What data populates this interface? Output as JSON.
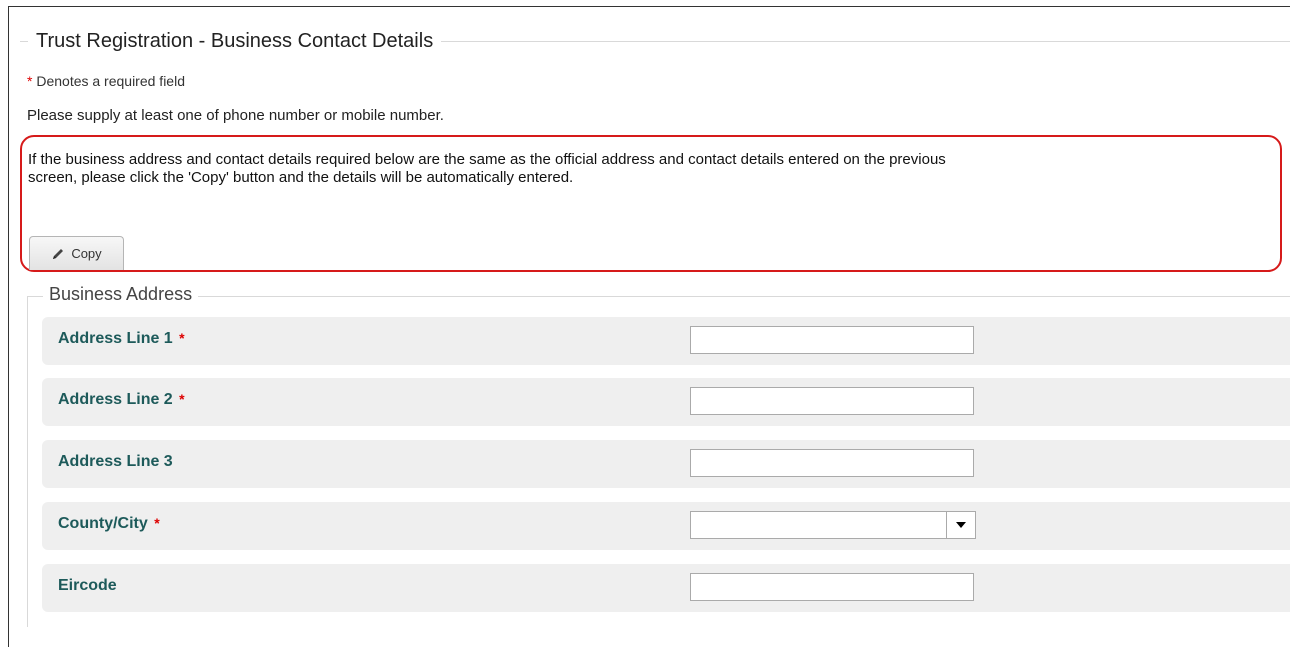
{
  "page_title": "Trust Registration - Business Contact Details",
  "required_note": {
    "star": "*",
    "text": "Denotes a required field"
  },
  "supply_note": "Please supply at least one of phone number or mobile number.",
  "copy_section": {
    "instruction_line1": "If the business address and contact details required below are the same as the official address and contact details entered on the previous",
    "instruction_line2": "screen, please click the 'Copy' button and the details will be automatically entered.",
    "button_label": "Copy",
    "button_icon": "pencil-icon",
    "highlight_color": "#d61a1a"
  },
  "business_address": {
    "legend": "Business Address",
    "fields": [
      {
        "label": "Address Line 1",
        "required": "*",
        "type": "text",
        "value": ""
      },
      {
        "label": "Address Line 2",
        "required": "*",
        "type": "text",
        "value": ""
      },
      {
        "label": "Address Line 3",
        "required": "",
        "type": "text",
        "value": ""
      },
      {
        "label": "County/City",
        "required": "*",
        "type": "select",
        "value": ""
      },
      {
        "label": "Eircode",
        "required": "",
        "type": "text",
        "value": ""
      }
    ]
  },
  "colors": {
    "label_text": "#1d5a5a",
    "required_star": "#dd0000",
    "row_background": "#efefef"
  }
}
